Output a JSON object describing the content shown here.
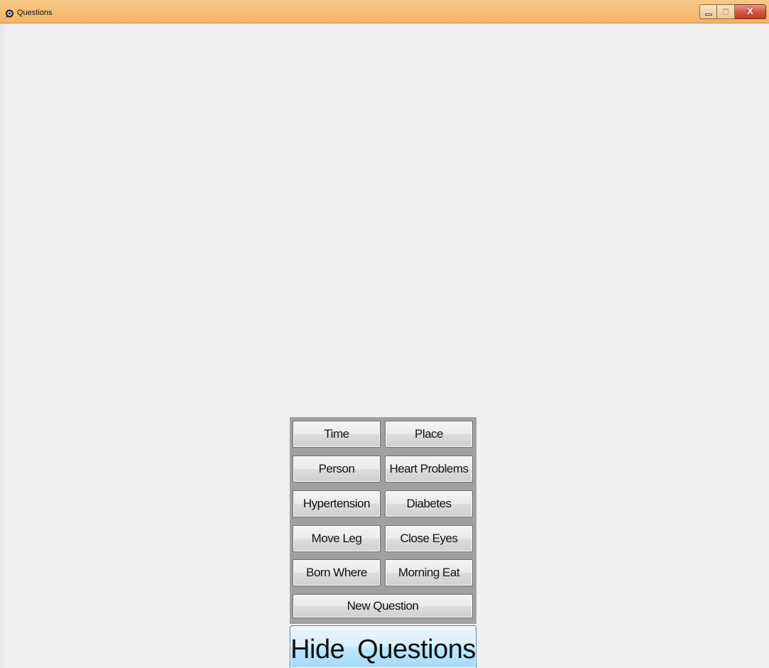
{
  "window": {
    "title": "Questions",
    "icon": "app-icon",
    "controls": [
      "minimize-icon",
      "maximize-icon",
      "close-icon"
    ],
    "close_label": "X"
  },
  "questions": {
    "buttons": [
      {
        "label": "Time"
      },
      {
        "label": "Place"
      },
      {
        "label": "Person"
      },
      {
        "label": "Heart Problems"
      },
      {
        "label": "Hypertension"
      },
      {
        "label": "Diabetes"
      },
      {
        "label": "Move Leg"
      },
      {
        "label": "Close Eyes"
      },
      {
        "label": "Born Where"
      },
      {
        "label": "Morning Eat"
      }
    ],
    "new_question_label": "New Question"
  },
  "hide_questions_label": "Hide  Questions",
  "colors": {
    "titlebar": "#f5bd73",
    "client": "#f0f0f0",
    "panel": "#a0a0a0",
    "hide_button": "#bee6fd",
    "close_button": "#c23b24"
  }
}
